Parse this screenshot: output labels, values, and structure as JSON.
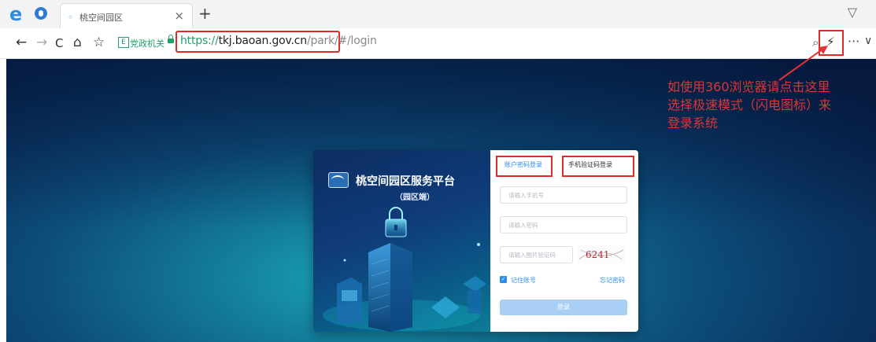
{
  "browser": {
    "tab_favicon": "◦",
    "tab_title": "桃空间园区",
    "tab_close": "×",
    "new_tab": "+",
    "bookmark_label": "党政机关",
    "bookmark_icon": "E",
    "url_scheme": "https://",
    "url_host": "tkj.baoan.gov.cn",
    "url_path": "/park/#/login",
    "nav": {
      "back": "←",
      "forward": "→",
      "refresh": "C",
      "home": "⌂",
      "favorite": "☆"
    },
    "toolbar": {
      "zoom": "⌕",
      "flash": "⚡",
      "more": "···",
      "chevron": "∨",
      "shield": "▽"
    }
  },
  "login_card": {
    "brand_name": "桃空间园区服务平台",
    "brand_sub": "（园区端）",
    "tab_password": "账户密码登录",
    "tab_sms": "手机验证码登录",
    "phone_placeholder": "请输入手机号",
    "password_placeholder": "请输入密码",
    "captcha_placeholder": "请输入图片验证码",
    "captcha_code": "6241",
    "remember_label": "记住账号",
    "remember_checked": true,
    "forgot_label": "忘记密码",
    "login_button": "登录"
  },
  "annotation": {
    "line1": "如使用360浏览器请点击这里",
    "line2": "选择极速模式（闪电图标）来",
    "line3": "登录系统",
    "color": "#e03434"
  },
  "colors": {
    "accent": "#2d8cf0",
    "highlight_box": "#e02b2b",
    "secure_green": "#22a06b"
  }
}
